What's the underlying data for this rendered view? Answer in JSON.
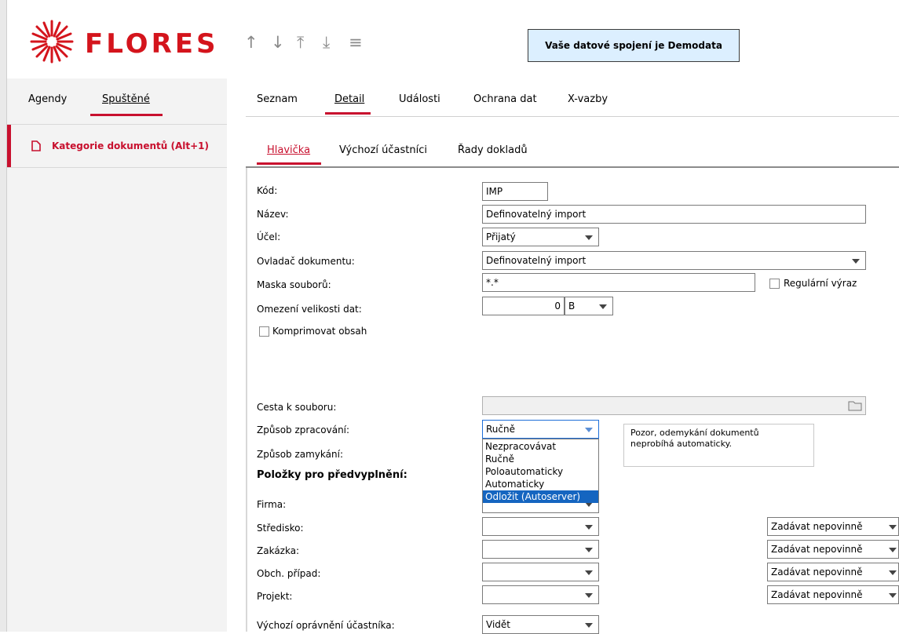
{
  "header": {
    "logo_text": "FLORES",
    "nav_icons": [
      "arrow-up-icon",
      "arrow-down-icon",
      "arrow-top-icon",
      "arrow-bottom-icon",
      "menu-icon"
    ],
    "connection_text": "Vaše datové spojení je Demodata"
  },
  "left_panel": {
    "tabs": [
      "Agendy",
      "Spuštěné"
    ],
    "active_tab": "Spuštěné",
    "items": [
      {
        "label": "Kategorie dokumentů (Alt+1)",
        "icon": "document-icon"
      }
    ]
  },
  "main_tabs": [
    {
      "label": "Seznam"
    },
    {
      "label": "Detail"
    },
    {
      "label": "Události"
    },
    {
      "label": "Ochrana dat"
    },
    {
      "label": "X-vazby"
    }
  ],
  "sub_tabs": [
    {
      "label": "Hlavička"
    },
    {
      "label": "Výchozí účastníci"
    },
    {
      "label": "Řady dokladů"
    }
  ],
  "form": {
    "kod_label": "Kód:",
    "kod_value": "IMP",
    "nazev_label": "Název:",
    "nazev_value": "Definovatelný import",
    "ucel_label": "Účel:",
    "ucel_value": "Přijatý",
    "ovladac_label": "Ovladač dokumentu:",
    "ovladac_value": "Definovatelný import",
    "maska_label": "Maska souborů:",
    "maska_value": "*.*",
    "regularni_label": "Regulární výraz",
    "omezeni_label": "Omezení velikosti dat:",
    "omezeni_value": "0",
    "omezeni_unit": "B",
    "komprimovat_label": "Komprimovat obsah",
    "cesta_label": "Cesta k souboru:",
    "zpusob_zpracovani_label": "Způsob zpracování:",
    "zpusob_zpracovani_value": "Ručně",
    "zpusob_zamykani_label": "Způsob zamykání:",
    "note_line1": "Pozor, odemykání dokumentů",
    "note_line2": "neprobíhá automaticky.",
    "dropdown_options": [
      "Nezpracovávat",
      "Ručně",
      "Poloautomaticky",
      "Automaticky",
      "Odložit (Autoserver)"
    ],
    "dropdown_selected": "Odložit (Autoserver)",
    "section_title": "Položky pro předvyplnění:",
    "firma_label": "Firma:",
    "stredisko_label": "Středisko:",
    "zakazka_label": "Zakázka:",
    "obch_label": "Obch. případ:",
    "projekt_label": "Projekt:",
    "zadavat_value": "Zadávat nepovinně",
    "opravneni_label": "Výchozí oprávnění účastníka:",
    "opravneni_value": "Vidět"
  },
  "colors": {
    "accent": "#c8102e",
    "connection_bg": "#dcefff",
    "selection": "#1565c0"
  }
}
